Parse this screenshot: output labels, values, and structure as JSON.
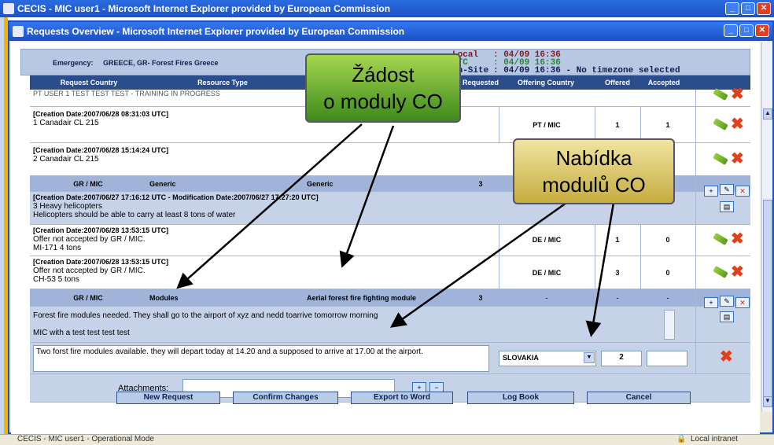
{
  "outer_window": {
    "title": "CECIS - MIC user1 - Microsoft Internet Explorer provided by European Commission"
  },
  "inner_window": {
    "title": "Requests Overview - Microsoft Internet Explorer provided by European Commission"
  },
  "emergency": {
    "label": "Emergency:",
    "value": "GREECE, GR- Forest Fires Greece"
  },
  "times": {
    "local_label": "Local",
    "local_value": ": 04/09 16:36",
    "utc_label": "UTC",
    "utc_value": ": 04/09 16:36",
    "onsite_label": "On-Site",
    "onsite_value": ": 04/09 16:36 - No timezone selected"
  },
  "table": {
    "headers": [
      "Request Country",
      "Resource Type",
      "",
      "Requested",
      "Offering Country",
      "Offered",
      "Accepted"
    ],
    "top_clip_text": "PT USER 1 TEST TEST TEST - TRAINING IN PROGRESS",
    "rows": [
      {
        "meta": "[Creation Date:2007/06/28 08:31:03 UTC]",
        "text": "1 Canadair CL 215",
        "country": "PT / MIC",
        "offered": "1",
        "accepted": "1"
      },
      {
        "meta": "[Creation Date:2007/06/28 15:14:24 UTC]",
        "text": "2 Canadair CL 215",
        "country": "",
        "offered": "",
        "accepted": ""
      }
    ],
    "group1": {
      "country": "GR / MIC",
      "type": "Generic",
      "module": "Generic",
      "requested": "3"
    },
    "group1_request": {
      "meta": "[Creation Date:2007/06/27 17:16:12 UTC  -  Modification Date:2007/06/27 17:27:20 UTC]",
      "line1": "3 Heavy helicopters",
      "line2": "Helicopters should be able to carry at least 8 tons of water"
    },
    "group1_offers": [
      {
        "meta": "[Creation Date:2007/06/28 13:53:15 UTC]",
        "line1": "Offer not accepted by GR / MIC.",
        "line2": "MI-171 4 tons",
        "country": "DE / MIC",
        "offered": "1",
        "accepted": "0"
      },
      {
        "meta": "[Creation Date:2007/06/28 13:53:15 UTC]",
        "line1": "Offer not accepted by GR / MIC.",
        "line2": "CH-53 5 tons",
        "country": "DE / MIC",
        "offered": "3",
        "accepted": "0"
      }
    ],
    "group2": {
      "country": "GR / MIC",
      "type": "Modules",
      "module": "Aerial forest fire fighting module",
      "requested": "3",
      "offering": "-",
      "offered": "-",
      "accepted": "-"
    },
    "group2_request": {
      "line1": "Forest fire modules needed. They shall go to the airport of xyz and nedd toarrive tomorrow morning",
      "line2": "MIC with a test   test   test   test"
    },
    "new_offer": {
      "text": "Two forst fire modules available. they will depart today at 14.20 and a supposed to arrive at 17.00 at the airport.",
      "country": "SLOVAKIA",
      "offered": "2",
      "accepted": ""
    },
    "attachments_label": "Attachments:"
  },
  "buttons": {
    "new_request": "New Request",
    "confirm_changes": "Confirm Changes",
    "export_to_word": "Export to Word",
    "log_book": "Log Book",
    "cancel": "Cancel"
  },
  "statusbar": {
    "text": "CECIS - MIC user1 - Operational Mode",
    "zone": "Local intranet"
  },
  "callouts": {
    "zadost_line1": "Žádost",
    "zadost_line2": "o moduly CO",
    "nabidka_line1": "Nabídka",
    "nabidka_line2": "modulů CO"
  },
  "colors": {
    "header": "#2c4d8c",
    "row_blue": "#c6d2e8",
    "local_time": "#8b1a1a",
    "utc_time": "#2a8a2a",
    "delete": "#e0401c"
  }
}
